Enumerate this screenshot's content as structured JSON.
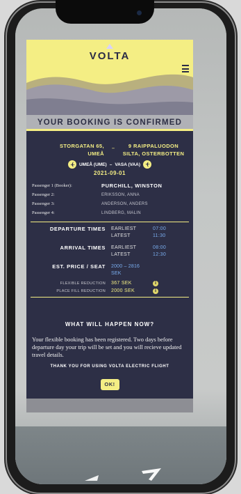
{
  "app": {
    "brand": "VOLTA",
    "confirmation_title": "YOUR BOOKING IS CONFIRMED"
  },
  "route": {
    "from_address": "STORGATAN 65, UMEÅ",
    "separator": "–",
    "to_address": "9 RAIPPALUODON SILTA, OSTERBOTTEN",
    "from_airport": "UMEÅ (UME)",
    "to_airport": "VASA (VAA)",
    "airport_separator": "–",
    "date": "2021-09-01"
  },
  "passengers": [
    {
      "label": "Passenger 1 (Booker):",
      "name": "PURCHILL, WINSTON"
    },
    {
      "label": "Passenger 2:",
      "name": "ERIKSSON, ANNA"
    },
    {
      "label": "Passenger 3:",
      "name": "ANDERSON, ANDERS"
    },
    {
      "label": "Passenger 4:",
      "name": "LINDBERG, MALIN"
    }
  ],
  "times": {
    "departure_label": "DEPARTURE TIMES",
    "arrival_label": "ARRIVAL TIMES",
    "earliest_label": "EARLIEST",
    "latest_label": "LATEST",
    "departure_earliest": "07:00",
    "departure_latest": "11:30",
    "arrival_earliest": "08:00",
    "arrival_latest": "12:30"
  },
  "price": {
    "label": "EST. PRICE / SEAT",
    "value": "2000 – 2816 SEK",
    "flexible_label": "FLEXIBLE REDUCTION",
    "flexible_value": "367 SEK",
    "placefill_label": "PLACE FILL REDUCTION",
    "placefill_value": "2000 SEK",
    "info_glyph": "i"
  },
  "next": {
    "title": "WHAT WILL HAPPEN NOW?",
    "body": "Your flexible booking has been registered. Two days before departure day your trip will be set and you will recieve updated travel details.",
    "thanks": "THANK YOU FOR USING VOLTA ELECTRIC FLIGHT",
    "ok_label": "OK!"
  },
  "colors": {
    "accent_yellow": "#f4ee84",
    "panel_navy": "#2d2f46",
    "value_blue": "#7aaef0"
  },
  "icons": [
    "menu-icon",
    "plane-icon",
    "info-icon"
  ]
}
